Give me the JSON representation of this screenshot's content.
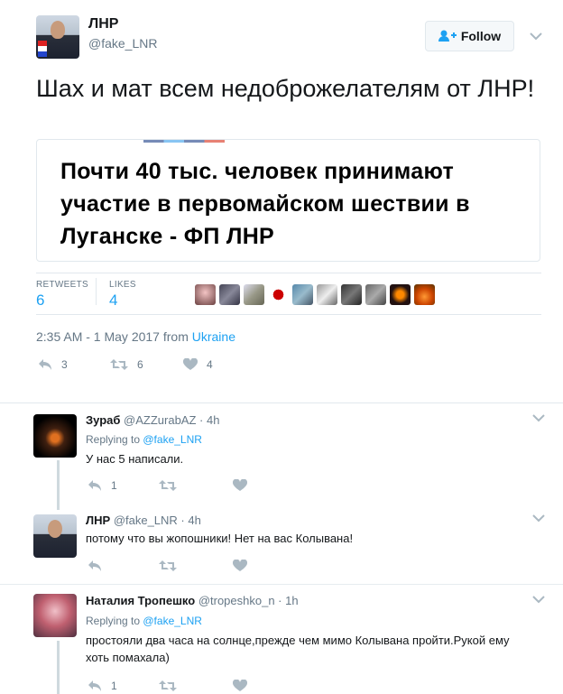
{
  "tweet": {
    "author_name": "ЛНР",
    "author_handle": "@fake_LNR",
    "follow_label": "Follow",
    "text": "Шах и мат всем недоброжелателям от ЛНР!",
    "card_title": "Почти 40 тыс. человек принимают участие в первомайском шествии в Луганске - ФП ЛНР",
    "retweets_label": "RETWEETS",
    "retweets_count": "6",
    "likes_label": "LIKES",
    "likes_count": "4",
    "timestamp": "2:35 AM - 1 May 2017 from ",
    "location": "Ukraine",
    "reply_count": "3",
    "retweet_count_action": "6",
    "like_count_action": "4"
  },
  "replies": [
    {
      "name": "Зураб",
      "handle": "@AZZurabAZ · 4h",
      "replying_prefix": "Replying to ",
      "replying_to": "@fake_LNR",
      "text": "У нас 5 написали.",
      "reply_count": "1"
    },
    {
      "name": "ЛНР",
      "handle": "@fake_LNR · 4h",
      "text": "потому что вы жопошники! Нет на вас Колывана!"
    },
    {
      "name": "Наталия Тропешко",
      "handle": "@tropeshko_n · 1h",
      "replying_prefix": "Replying to ",
      "replying_to": "@fake_LNR",
      "text": "простояли два часа на солнце,прежде чем мимо Колывана пройти.Рукой ему хоть помахала)",
      "reply_count": "1"
    }
  ],
  "colors": {
    "accent": "#1da1f2",
    "muted": "#657786",
    "like_icon": "#aab8c2"
  }
}
